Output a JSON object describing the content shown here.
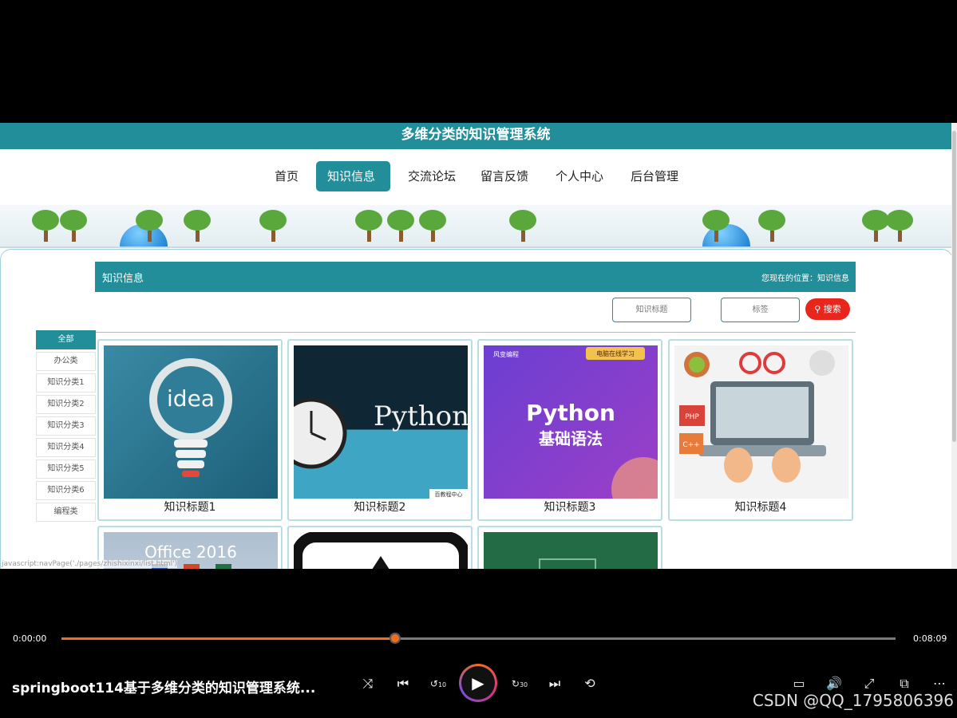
{
  "site": {
    "title": "多维分类的知识管理系统",
    "nav": [
      {
        "label": "首页",
        "active": false
      },
      {
        "label": "知识信息",
        "active": true
      },
      {
        "label": "交流论坛",
        "active": false
      },
      {
        "label": "留言反馈",
        "active": false
      },
      {
        "label": "个人中心",
        "active": false
      },
      {
        "label": "后台管理",
        "active": false
      }
    ],
    "accent_color": "#218e9a"
  },
  "section": {
    "title": "知识信息",
    "breadcrumb": "您现在的位置：知识信息"
  },
  "filters": {
    "title_placeholder": "知识标题",
    "tag_placeholder": "标签",
    "search_label": "搜索",
    "search_icon": "search-icon"
  },
  "categories": [
    {
      "label": "全部",
      "active": true
    },
    {
      "label": "办公类"
    },
    {
      "label": "知识分类1"
    },
    {
      "label": "知识分类2"
    },
    {
      "label": "知识分类3"
    },
    {
      "label": "知识分类4"
    },
    {
      "label": "知识分类5"
    },
    {
      "label": "知识分类6"
    },
    {
      "label": "编程类"
    }
  ],
  "cards": [
    {
      "title": "知识标题1",
      "image_text": "idea"
    },
    {
      "title": "知识标题2",
      "image_text": "Python",
      "badge": "百教程中心"
    },
    {
      "title": "知识标题3",
      "image_text": "Python",
      "image_subtext": "基础语法",
      "badge": "电脑在线学习",
      "brand": "风变编程"
    },
    {
      "title": "知识标题4",
      "image_text": "PHP",
      "image_subtext": "C++"
    },
    {
      "title": "",
      "image_text": "Office 2016"
    },
    {
      "title": "",
      "image_text": ""
    },
    {
      "title": "",
      "image_text": ""
    }
  ],
  "status_url": "javascript:navPage('./pages/zhishixinxi/list.html')",
  "player": {
    "current_time": "0:00:00",
    "total_time": "0:08:09",
    "progress": 0.4,
    "video_title": "springboot114基于多维分类的知识管理系统...",
    "rewind_label": "10",
    "forward_label": "30",
    "accent_color": "#f36d21"
  },
  "watermark": "CSDN @QQ_1795806396"
}
